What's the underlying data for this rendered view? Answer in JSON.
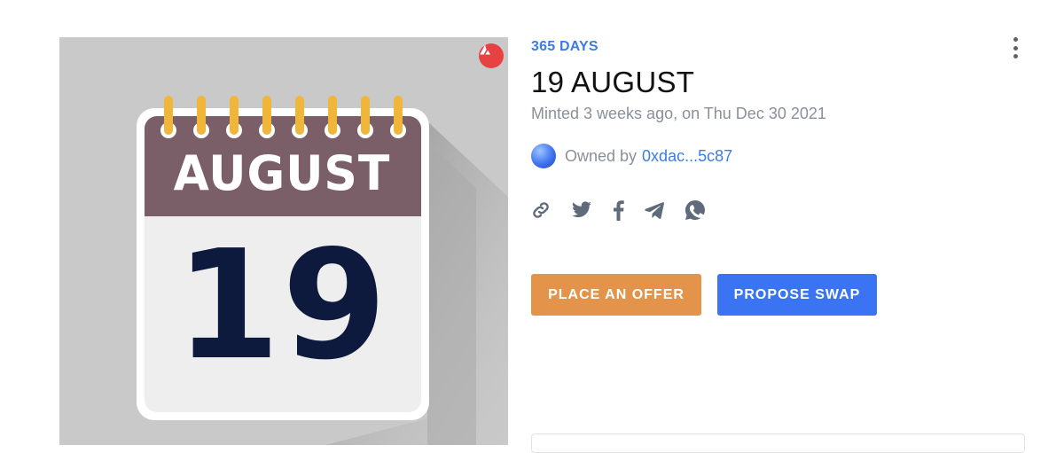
{
  "artwork": {
    "calendar_month": "AUGUST",
    "calendar_day": "19",
    "chain_badge_icon": "avalanche-logo-icon",
    "colors": {
      "background": "#c9c9c9",
      "calendar_header": "#7a5f69",
      "calendar_body": "#eeeeee",
      "ring": "#f0b63a",
      "day_number": "#0e1a3d"
    }
  },
  "details": {
    "collection_name": "365 DAYS",
    "title": "19 AUGUST",
    "minted_text": "Minted 3 weeks ago, on Thu Dec 30 2021",
    "owned_by_label": "Owned by",
    "owner_address": "0xdac...5c87"
  },
  "share_icons": [
    "link-icon",
    "twitter-icon",
    "facebook-icon",
    "telegram-icon",
    "whatsapp-icon"
  ],
  "actions": {
    "place_offer_label": "PLACE AN OFFER",
    "propose_swap_label": "PROPOSE SWAP"
  },
  "colors": {
    "accent_blue": "#3b7de0",
    "offer_button": "#e3944a",
    "swap_button": "#3b74f2",
    "muted_text": "#8a8f98"
  },
  "menu": {
    "more_icon": "more-vertical-icon"
  }
}
